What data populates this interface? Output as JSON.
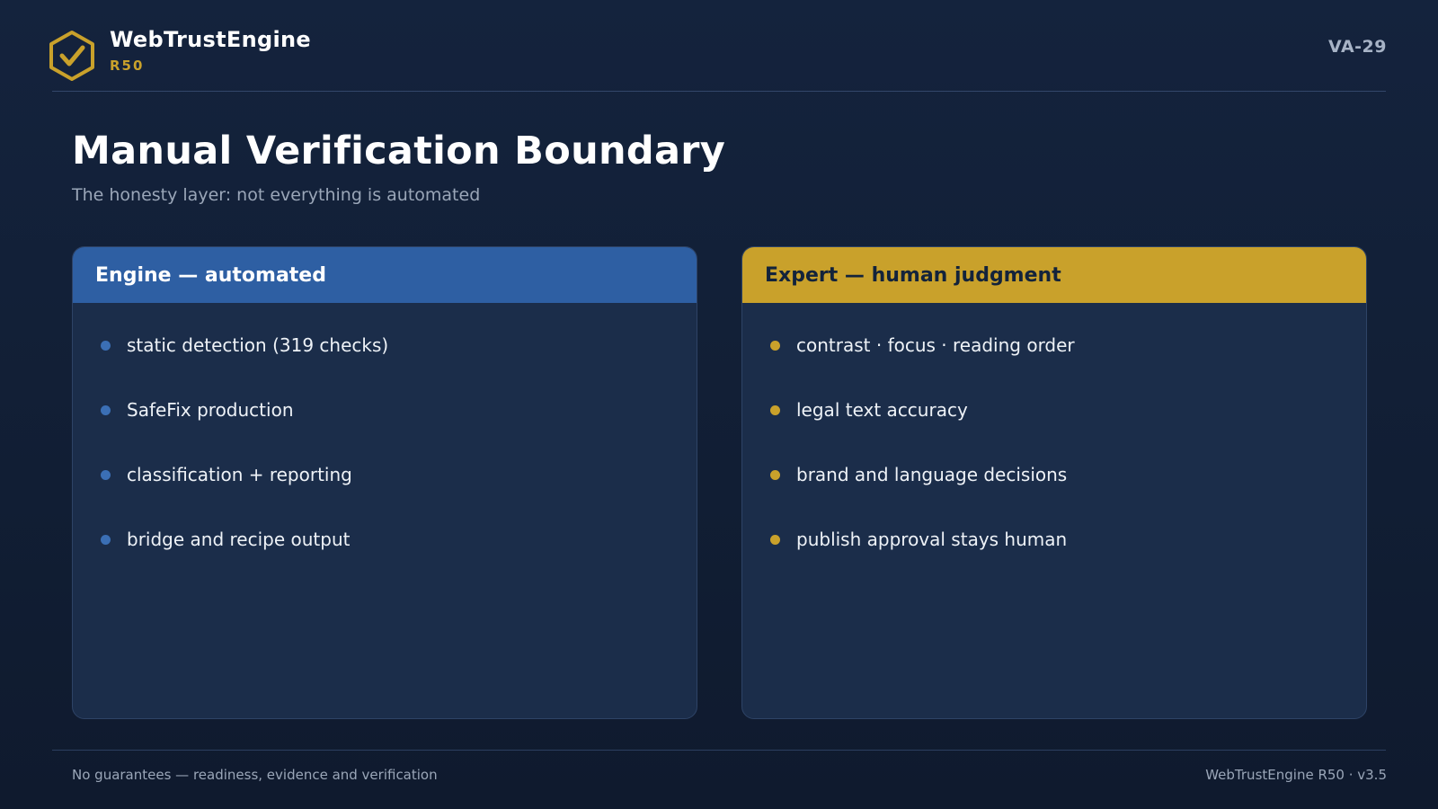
{
  "brand": {
    "name": "WebTrustEngine",
    "version": "R50",
    "logo_icon": "hexagon-check-icon"
  },
  "slide_id": "VA-29",
  "title": "Manual Verification Boundary",
  "subtitle": "The honesty layer: not everything is automated",
  "cards": [
    {
      "heading": "Engine — automated",
      "accent_color": "#2e5fa3",
      "items": [
        "static detection (319 checks)",
        "SafeFix production",
        "classification + reporting",
        "bridge and recipe output"
      ]
    },
    {
      "heading": "Expert — human judgment",
      "accent_color": "#c9a12b",
      "items": [
        "contrast · focus · reading order",
        "legal text accuracy",
        "brand and language decisions",
        "publish approval stays human"
      ]
    }
  ],
  "footer": {
    "left": "No guarantees — readiness, evidence and verification",
    "right": "WebTrustEngine R50 · v3.5"
  },
  "colors": {
    "background": "#13223a",
    "brand_gold": "#c9a12b",
    "brand_blue": "#2e5fa3",
    "card_bg": "#1b2d4a"
  }
}
